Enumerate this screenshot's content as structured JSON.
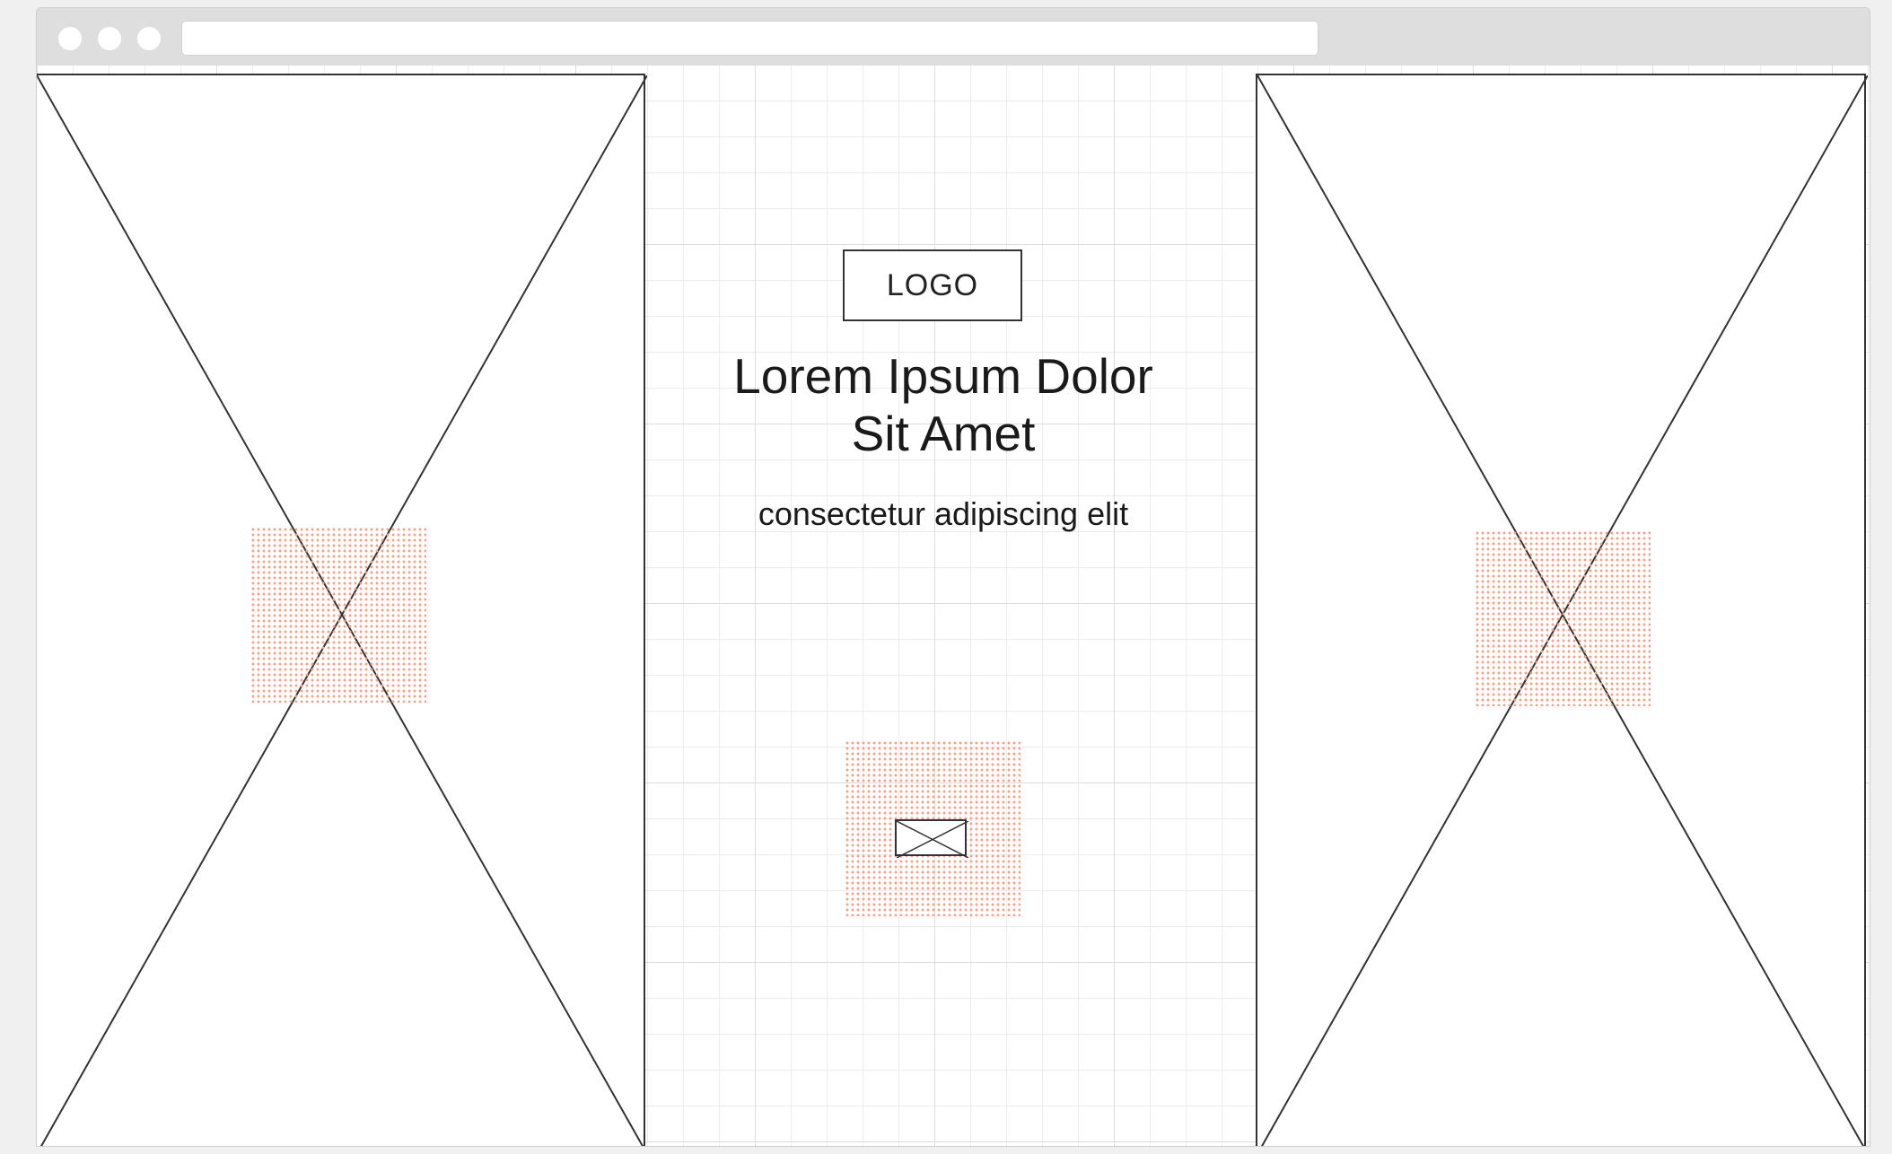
{
  "window": {
    "controls": [
      "close",
      "minimize",
      "maximize"
    ],
    "url": ""
  },
  "hero": {
    "logo_label": "LOGO",
    "headline_line1": "Lorem Ipsum Dolor",
    "headline_line2": "Sit Amet",
    "subheadline": "consectetur adipiscing elit"
  },
  "colors": {
    "placeholder_stroke": "#333333",
    "dot_pattern": "#f4a08c",
    "grid_line": "#dcdcdc"
  }
}
